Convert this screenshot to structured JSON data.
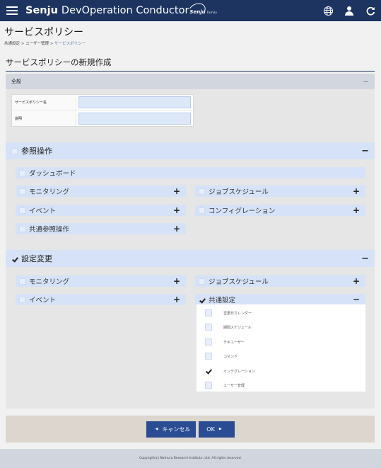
{
  "header": {
    "brand_bold": "Senju",
    "brand_rest": "DevOperation Conductor",
    "brand_family": "Senju",
    "brand_family_small": "Family",
    "icons": [
      "menu-icon",
      "globe-icon",
      "user-icon",
      "refresh-icon"
    ]
  },
  "page": {
    "title": "サービスポリシー",
    "breadcrumb": [
      "共通設定",
      "ユーザー管理",
      "サービスポリシー"
    ],
    "section_heading": "サービスポリシーの新規作成"
  },
  "general": {
    "title": "全般",
    "collapse": "−",
    "fields": [
      {
        "label": "サービスポリシー名",
        "value": ""
      },
      {
        "label": "説明",
        "value": ""
      }
    ]
  },
  "reference_ops": {
    "title": "参照操作",
    "checked": false,
    "toggle": "−",
    "items": {
      "dashboard": {
        "label": "ダッシュボード"
      },
      "monitoring": {
        "label": "モニタリング",
        "toggle": "+"
      },
      "job_schedule": {
        "label": "ジョブスケジュール",
        "toggle": "+"
      },
      "event": {
        "label": "イベント",
        "toggle": "+"
      },
      "configuration": {
        "label": "コンフィグレーション",
        "toggle": "+"
      },
      "common_ref": {
        "label": "共通参照操作",
        "toggle": "+"
      }
    }
  },
  "settings_change": {
    "title": "設定変更",
    "checked": true,
    "toggle": "−",
    "items": {
      "monitoring": {
        "label": "モニタリング",
        "toggle": "+"
      },
      "job_schedule": {
        "label": "ジョブスケジュール",
        "toggle": "+"
      },
      "event": {
        "label": "イベント",
        "toggle": "+"
      },
      "common_settings": {
        "label": "共通設定",
        "toggle": "−",
        "checked": true
      }
    },
    "common_settings_sub": [
      {
        "label": "営業日カレンダー",
        "checked": false
      },
      {
        "label": "期間スケジュール",
        "checked": false
      },
      {
        "label": "チキユーザー",
        "checked": false
      },
      {
        "label": "コマンド",
        "checked": false
      },
      {
        "label": "インテグレーション",
        "checked": true
      },
      {
        "label": "ユーザー管理",
        "checked": false
      }
    ]
  },
  "buttons": {
    "cancel": "キャンセル",
    "cancel_arrow": "◀",
    "ok": "OK",
    "ok_arrow": "▶"
  },
  "footer": {
    "copyright": "Copyright(c) Nomura Research Institute, Ltd. All rights reserved."
  },
  "colors": {
    "header_bg": "#1d3461",
    "accent_blue": "#2a4c93",
    "group_bg": "#d5e2f7",
    "footer_bar": "#dcd6cf"
  }
}
